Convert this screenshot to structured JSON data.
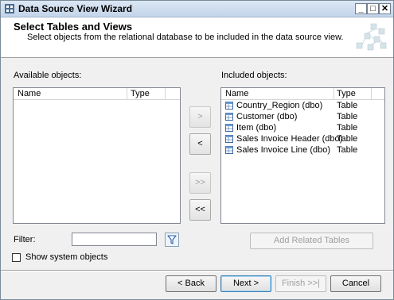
{
  "window": {
    "title": "Data Source View Wizard",
    "controls": {
      "minimize": "_",
      "maximize": "□",
      "close": "✕"
    }
  },
  "header": {
    "title": "Select Tables and Views",
    "subtitle": "Select objects from the relational database to be included in the data source view."
  },
  "available": {
    "label": "Available objects:",
    "columns": [
      "Name",
      "Type"
    ],
    "rows": []
  },
  "included": {
    "label": "Included objects:",
    "columns": [
      "Name",
      "Type"
    ],
    "rows": [
      {
        "name": "Country_Region (dbo)",
        "type": "Table"
      },
      {
        "name": "Customer (dbo)",
        "type": "Table"
      },
      {
        "name": "Item (dbo)",
        "type": "Table"
      },
      {
        "name": "Sales Invoice Header (dbo)",
        "type": "Table"
      },
      {
        "name": "Sales Invoice Line (dbo)",
        "type": "Table"
      }
    ]
  },
  "move_buttons": {
    "add": ">",
    "remove": "<",
    "add_all": ">>",
    "remove_all": "<<"
  },
  "filter": {
    "label": "Filter:",
    "value": ""
  },
  "add_related_label": "Add Related Tables",
  "show_system_objects": {
    "label": "Show system objects",
    "checked": false
  },
  "footer": {
    "back": "< Back",
    "next": "Next >",
    "finish": "Finish >>|",
    "cancel": "Cancel"
  },
  "icons": {
    "title": "wizard-app-icon",
    "header": "data-source-view-graphic-icon",
    "table": "table-icon",
    "filter": "funnel-icon"
  }
}
